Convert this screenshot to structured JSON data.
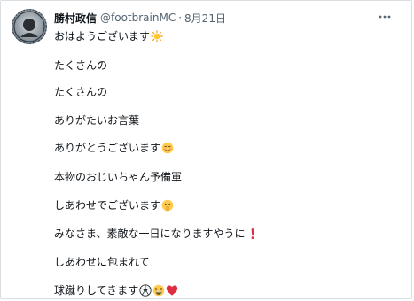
{
  "author": {
    "name": "勝村政信",
    "handle": "@footbrainMC",
    "separator": "·",
    "date": "8月21日"
  },
  "post": {
    "lines": [
      {
        "text": "おはようございます",
        "emoji": [
          "sun-emoji"
        ]
      },
      {
        "text": "たくさんの",
        "emoji": []
      },
      {
        "text": "たくさんの",
        "emoji": []
      },
      {
        "text": "ありがたいお言葉",
        "emoji": []
      },
      {
        "text": "ありがとうございます",
        "emoji": [
          "smiling-face-emoji"
        ]
      },
      {
        "text": "本物のおじいちゃん予備軍",
        "emoji": []
      },
      {
        "text": "しあわせでございます",
        "emoji": [
          "shushing-face-emoji"
        ]
      },
      {
        "text": "みなさま、素敵な一日になりますやうに",
        "emoji": [
          "red-exclamation-emoji"
        ]
      },
      {
        "text": "しあわせに包まれて",
        "emoji": []
      },
      {
        "text": "球蹴りしてきます",
        "emoji": [
          "soccer-ball-emoji",
          "grinning-squint-emoji",
          "red-heart-emoji"
        ]
      }
    ]
  },
  "colors": {
    "text": "#0f1419",
    "secondary": "#536471",
    "border": "#d9dee2"
  }
}
